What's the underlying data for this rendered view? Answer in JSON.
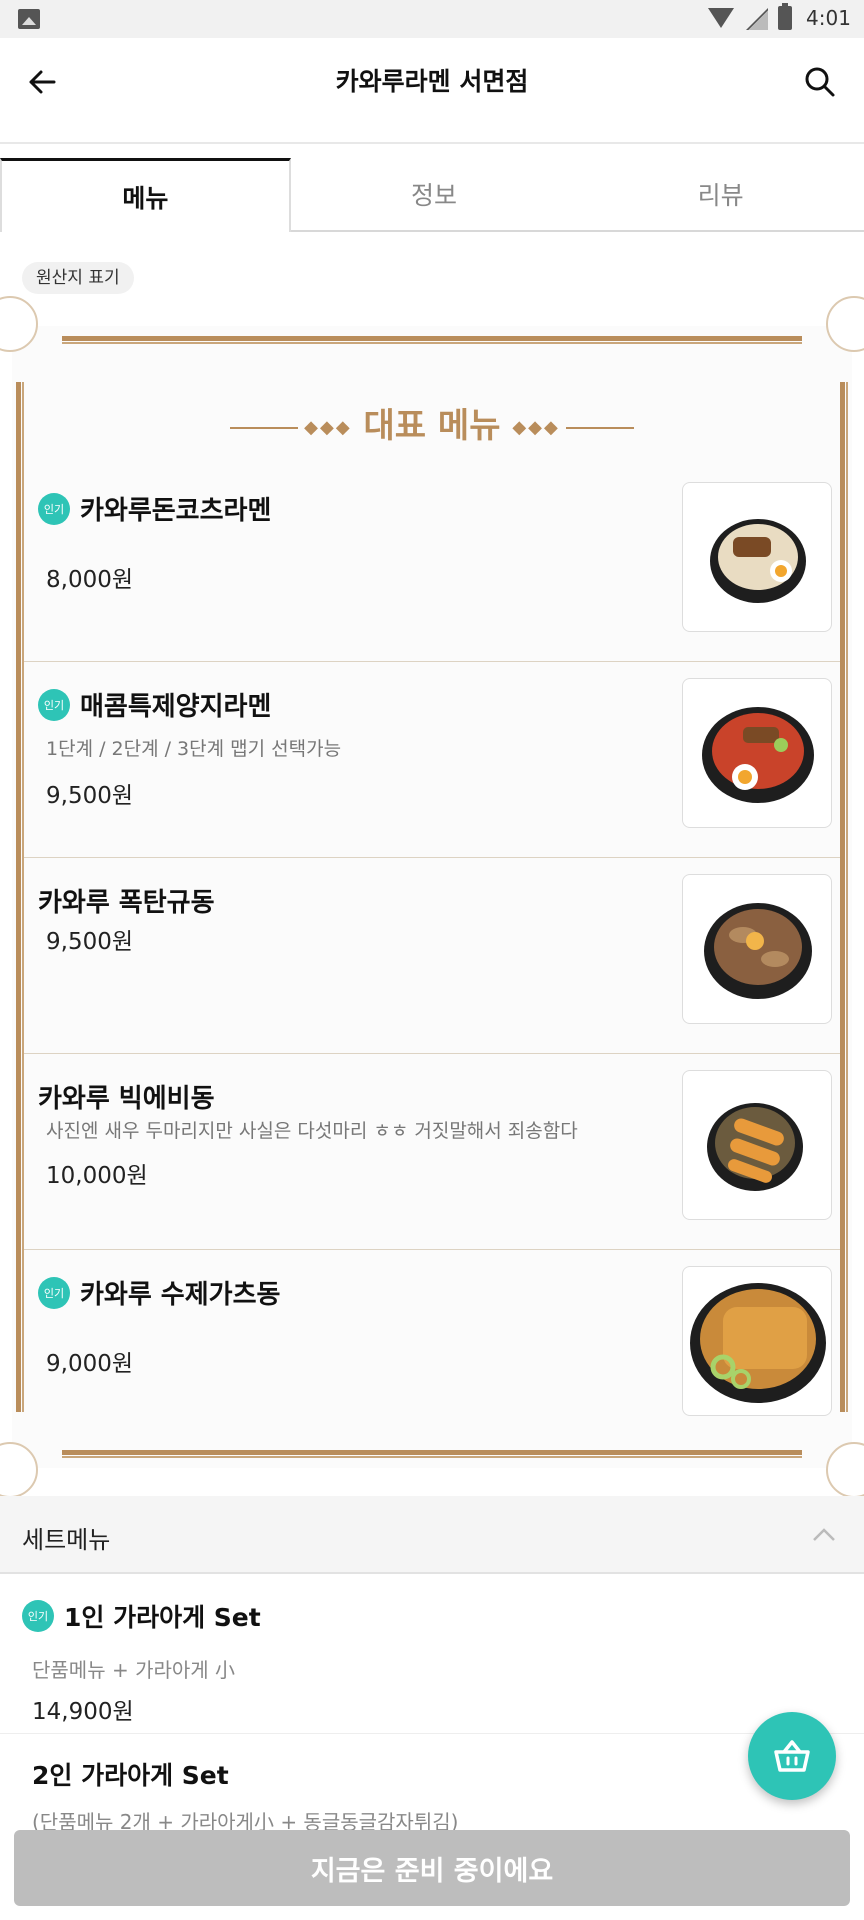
{
  "status_bar": {
    "time": "4:01"
  },
  "header": {
    "title": "카와루라멘 서면점"
  },
  "tabs": [
    {
      "label": "메뉴",
      "active": true
    },
    {
      "label": "정보",
      "active": false
    },
    {
      "label": "리뷰",
      "active": false
    }
  ],
  "origin_label": "원산지 표기",
  "featured": {
    "title": "대표 메뉴",
    "items": [
      {
        "popular": true,
        "badge": "인기",
        "name": "카와루돈코츠라멘",
        "description": "",
        "price": "8,000원",
        "image": "ramen-bowl-icon"
      },
      {
        "popular": true,
        "badge": "인기",
        "name": "매콤특제양지라멘",
        "description": "1단계 / 2단계 / 3단계 맵기 선택가능",
        "price": "9,500원",
        "image": "spicy-ramen-bowl-icon"
      },
      {
        "popular": false,
        "badge": "",
        "name": "카와루 폭탄규동",
        "description": "",
        "price": "9,500원",
        "image": "gyudon-bowl-icon"
      },
      {
        "popular": false,
        "badge": "",
        "name": "카와루 빅에비동",
        "description": "사진엔 새우 두마리지만 사실은 다섯마리 ㅎㅎ 거짓말해서 죄송함다",
        "price": "10,000원",
        "image": "ebidon-bowl-icon"
      },
      {
        "popular": true,
        "badge": "인기",
        "name": "카와루 수제가츠동",
        "description": "",
        "price": "9,000원",
        "image": "katsudon-bowl-icon"
      }
    ]
  },
  "set_menu": {
    "label": "세트메뉴",
    "expanded": true,
    "items": [
      {
        "popular": true,
        "badge": "인기",
        "name": "1인 가라아게 Set",
        "description": "단품메뉴 + 가라아게 小",
        "price": "14,900원"
      },
      {
        "popular": false,
        "badge": "",
        "name": "2인 가라아게 Set",
        "description": "(단품메뉴 2개 + 가라아게小 + 동글동글감자튀김)",
        "price": ""
      }
    ]
  },
  "order_button": {
    "label": "지금은 준비 중이에요"
  },
  "colors": {
    "accent": "#2ec4b6",
    "frame_gold": "#b98d5b",
    "disabled": "#bdbdbd"
  }
}
